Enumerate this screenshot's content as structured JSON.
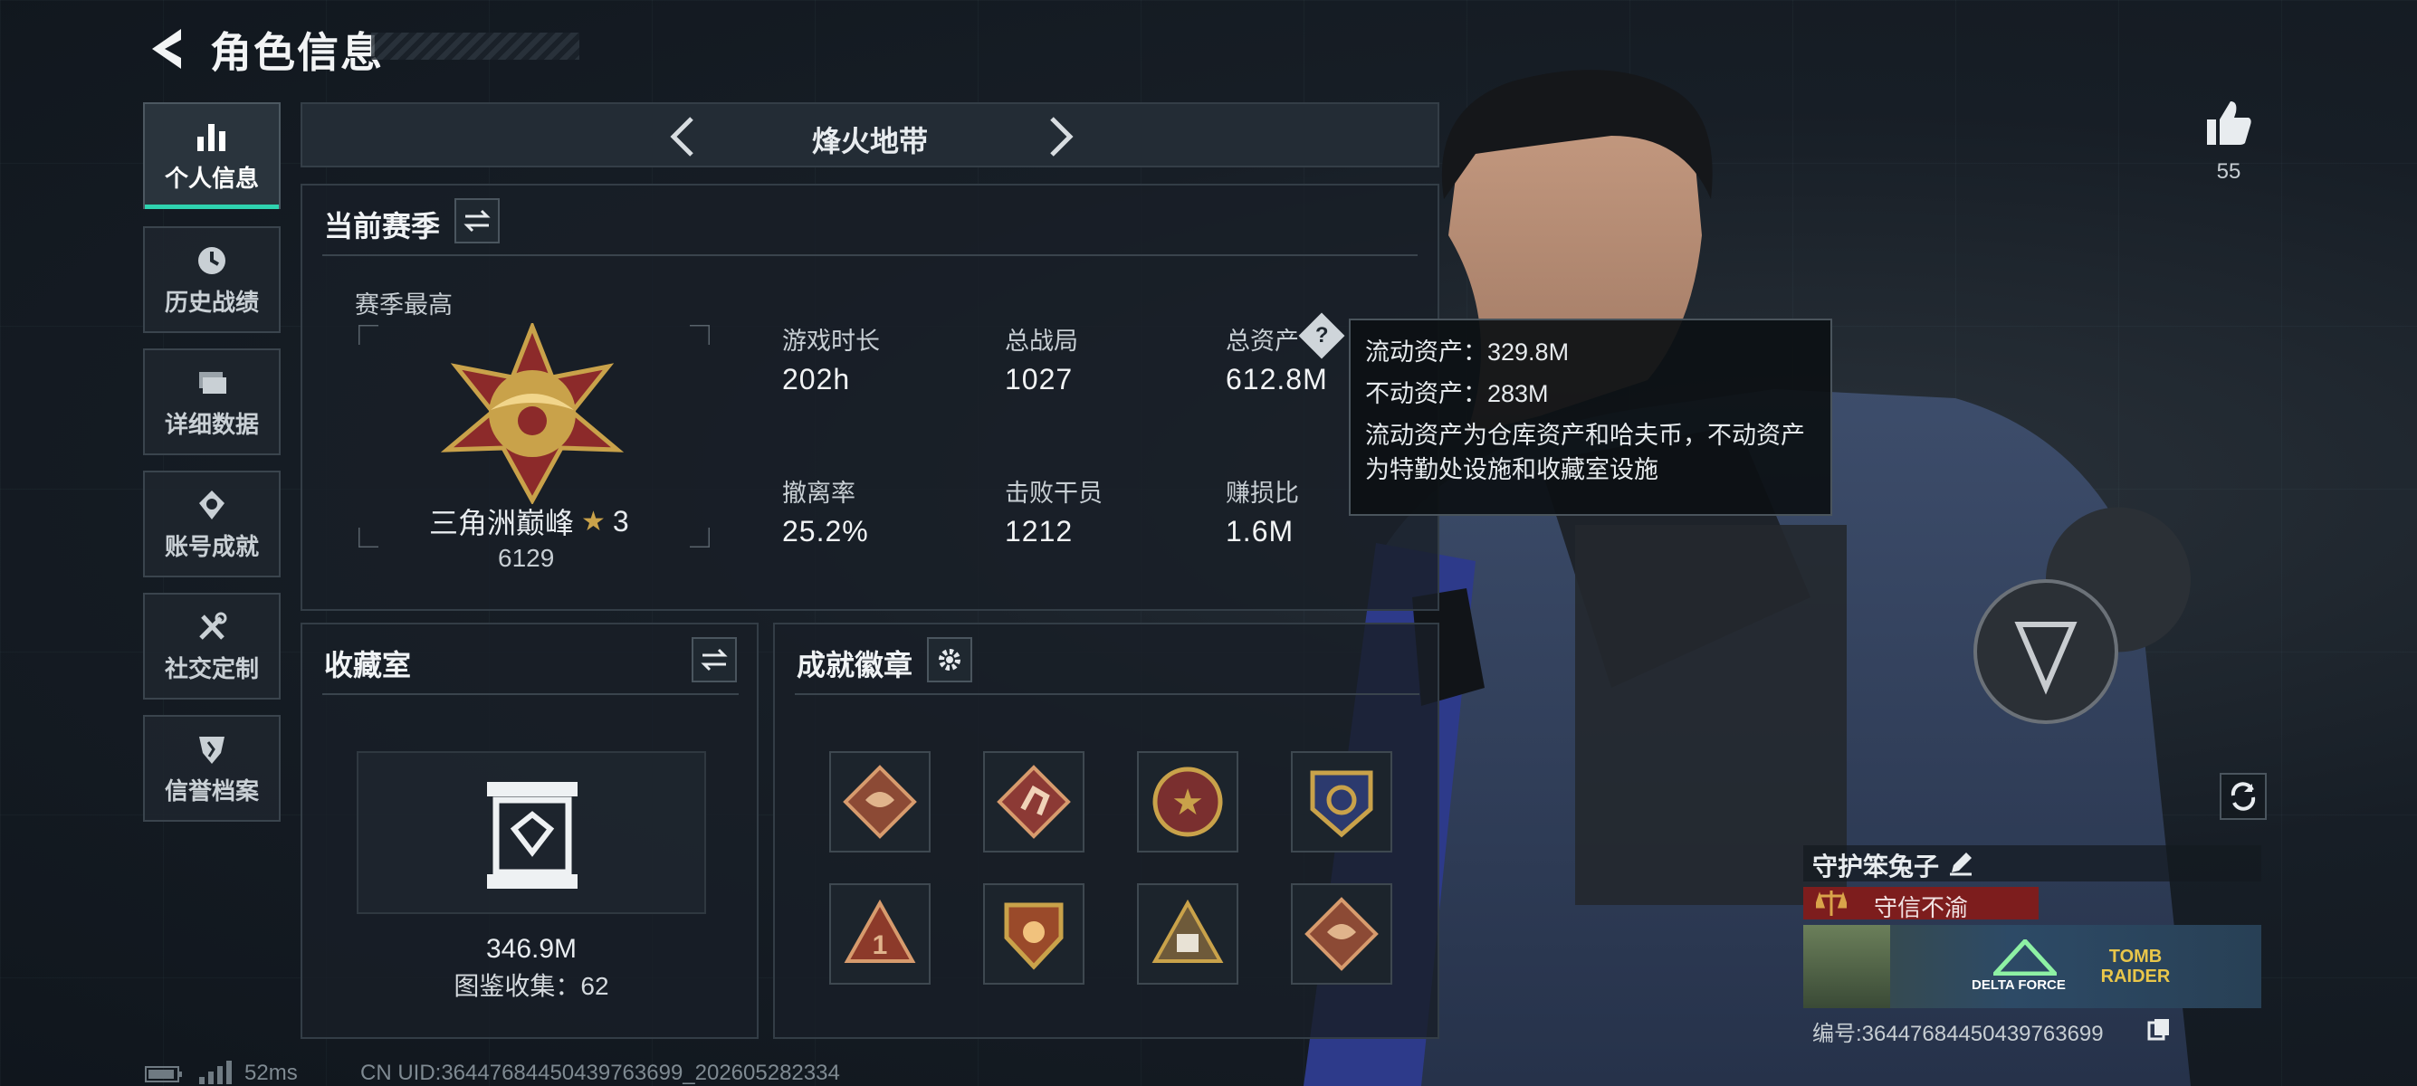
{
  "header": {
    "title": "角色信息"
  },
  "nav": [
    {
      "label": "个人信息",
      "icon": "bar-chart-icon",
      "active": true
    },
    {
      "label": "历史战绩",
      "icon": "clock-icon"
    },
    {
      "label": "详细数据",
      "icon": "folder-icon"
    },
    {
      "label": "账号成就",
      "icon": "achievement-icon"
    },
    {
      "label": "社交定制",
      "icon": "tools-icon"
    },
    {
      "label": "信誉档案",
      "icon": "shield-icon"
    }
  ],
  "mode": {
    "name": "烽火地带"
  },
  "season": {
    "title": "当前赛季",
    "best_label": "赛季最高",
    "rank_name": "三角洲巅峰",
    "rank_stars": "3",
    "rank_points": "6129",
    "stats": [
      {
        "label": "游戏时长",
        "value": "202h"
      },
      {
        "label": "总战局",
        "value": "1027"
      },
      {
        "label": "总资产",
        "value": "612.8M"
      },
      {
        "label": "撤离率",
        "value": "25.2%"
      },
      {
        "label": "击败干员",
        "value": "1212"
      },
      {
        "label": "赚损比",
        "value": "1.6M"
      }
    ]
  },
  "tooltip": {
    "liquid": "流动资产：329.8M",
    "fixed": "不动资产：283M",
    "desc_line1": "流动资产为仓库资产和哈夫币，不动资产",
    "desc_line2": "为特勤处设施和收藏室设施"
  },
  "collection": {
    "title": "收藏室",
    "value": "346.9M",
    "count": "图鉴收集：62"
  },
  "achievements": {
    "title": "成就徽章",
    "badges": [
      "dragon-badge",
      "runner-badge",
      "star-medal-badge",
      "eagle-badge",
      "rank-one-badge",
      "shield-badge",
      "number-58-badge",
      "dragon-badge"
    ]
  },
  "likes": {
    "count": "55"
  },
  "profile": {
    "nickname": "守护笨兔子",
    "reputation": "守信不渝",
    "banner_logo1": "DELTA FORCE",
    "banner_logo2": "TOMB RAIDER",
    "id": "编号:36447684450439763699"
  },
  "status": {
    "ping": "52ms",
    "uid": "CN UID:36447684450439763699_202605282334"
  },
  "colors": {
    "accent": "#2fd3b0",
    "reputation_bar": "#8a1f1f",
    "gold": "#c9a24a"
  }
}
